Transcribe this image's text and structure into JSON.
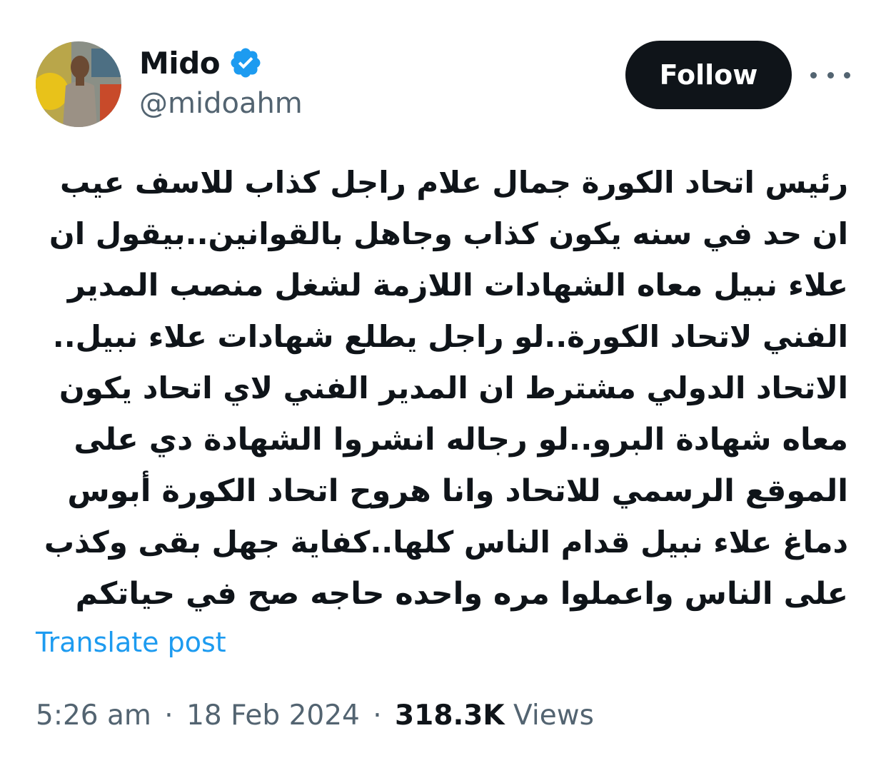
{
  "author": {
    "display_name": "Mido",
    "handle": "@midoahm",
    "verified": true,
    "verified_color": "#1d9bf0"
  },
  "actions": {
    "follow_label": "Follow",
    "more_icon": "more-horizontal-icon"
  },
  "tweet": {
    "lines": [
      "رئيس اتحاد الكورة جمال علام راجل كذاب للاسف عيب",
      "ان حد في سنه يكون كذاب وجاهل بالقوانين..بيقول ان",
      "علاء نبيل معاه الشهادات اللازمة لشغل منصب المدير",
      "الفني لاتحاد الكورة..لو راجل يطلع شهادات علاء نبيل..",
      "الاتحاد الدولي مشترط ان المدير الفني لاي اتحاد يكون",
      "معاه شهادة البرو..لو رجاله انشروا الشهادة دي على",
      "الموقع الرسمي للاتحاد وانا هروح اتحاد الكورة أبوس",
      "دماغ علاء نبيل قدام الناس كلها..كفاية جهل بقى وكذب",
      "على الناس واعملوا مره واحده حاجه صح في حياتكم"
    ],
    "translate_label": "Translate post"
  },
  "meta": {
    "time": "5:26 am",
    "separator": "·",
    "date": "18 Feb 2024",
    "views_count": "318.3K",
    "views_label": "Views"
  },
  "colors": {
    "text": "#0f1419",
    "secondary": "#536471",
    "link": "#1d9bf0",
    "button_bg": "#0f1419"
  }
}
